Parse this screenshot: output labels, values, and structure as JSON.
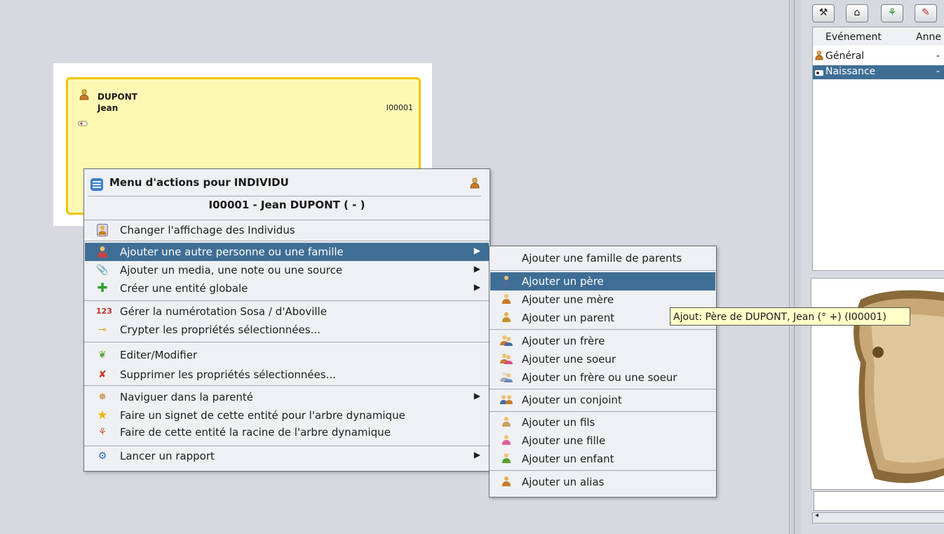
{
  "card": {
    "surname": "DUPONT",
    "given_name": "Jean",
    "id": "I00001"
  },
  "event_table": {
    "col_event": "Evénement",
    "col_year": "Anne",
    "rows": [
      {
        "label": "Général",
        "value": "-"
      },
      {
        "label": "Naissance",
        "value": "-"
      }
    ]
  },
  "main_menu": {
    "title": "Menu d'actions pour INDIVIDU",
    "subtitle": "I00001 - Jean DUPONT ( - )",
    "items": [
      {
        "label": "Changer l'affichage des Individus",
        "icon": "person-display-icon"
      },
      {
        "label": "Ajouter une autre personne ou une famille",
        "icon": "add-person-icon",
        "submenu": true
      },
      {
        "label": "Ajouter un media, une note ou une source",
        "icon": "paperclip-icon",
        "submenu": true
      },
      {
        "label": "Créer une entité globale",
        "icon": "plus-icon",
        "submenu": true
      },
      {
        "label": "Gérer la numérotation Sosa / d'Aboville",
        "icon": "numbers-icon"
      },
      {
        "label": "Crypter les propriétés sélectionnées...",
        "icon": "key-icon"
      },
      {
        "label": "Editer/Modifier",
        "icon": "edit-leaf-icon"
      },
      {
        "label": "Supprimer les propriétés sélectionnées...",
        "icon": "delete-icon"
      },
      {
        "label": "Naviguer dans la parenté",
        "icon": "navigate-icon",
        "submenu": true
      },
      {
        "label": "Faire un signet de cette entité pour l'arbre dynamique",
        "icon": "star-icon"
      },
      {
        "label": "Faire de cette entité la racine de l'arbre dynamique",
        "icon": "tree-root-icon"
      },
      {
        "label": "Lancer un rapport",
        "icon": "report-icon",
        "submenu": true
      }
    ]
  },
  "sub_menu": {
    "items": [
      {
        "label": "Ajouter une famille de parents"
      },
      {
        "label": "Ajouter un père",
        "icon": "father-icon"
      },
      {
        "label": "Ajouter une mère",
        "icon": "mother-icon"
      },
      {
        "label": "Ajouter un parent",
        "icon": "parent-icon"
      },
      {
        "label": "Ajouter un frère",
        "icon": "brother-icon"
      },
      {
        "label": "Ajouter une soeur",
        "icon": "sister-icon"
      },
      {
        "label": "Ajouter un frère ou une soeur",
        "icon": "sibling-icon"
      },
      {
        "label": "Ajouter un conjoint",
        "icon": "spouse-icon"
      },
      {
        "label": "Ajouter un fils",
        "icon": "son-icon"
      },
      {
        "label": "Ajouter une fille",
        "icon": "daughter-icon"
      },
      {
        "label": "Ajouter un enfant",
        "icon": "child-icon"
      },
      {
        "label": "Ajouter un alias",
        "icon": "alias-icon"
      }
    ]
  },
  "tooltip": "Ajout: Père de DUPONT, Jean (° +) (I00001)",
  "colors": {
    "highlight": "#3f6e95",
    "card_bg": "#fcf8b4",
    "card_border": "#f2c200",
    "tooltip_bg": "#ffffc8"
  }
}
